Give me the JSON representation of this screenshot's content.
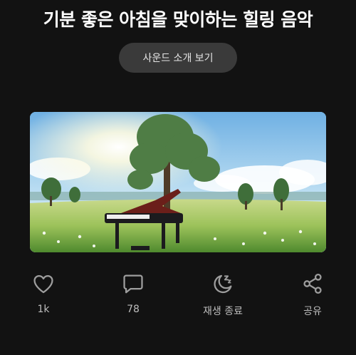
{
  "header": {
    "title": "기분 좋은 아침을 맞이하는 힐링 음악"
  },
  "intro_button": {
    "label": "사운드 소개 보기"
  },
  "artwork": {
    "icon": "grand-piano-in-meadow-image"
  },
  "actions": [
    {
      "id": "like",
      "icon": "heart-icon",
      "label": "1k"
    },
    {
      "id": "comment",
      "icon": "comment-icon",
      "label": "78"
    },
    {
      "id": "sleep-timer",
      "icon": "moon-zz-icon",
      "label": "재생 종료"
    },
    {
      "id": "share",
      "icon": "share-icon",
      "label": "공유"
    }
  ],
  "colors": {
    "background": "#121212",
    "button_bg": "#3a3a3a",
    "icon": "#9e9e9e",
    "label": "#bdbdbd"
  }
}
